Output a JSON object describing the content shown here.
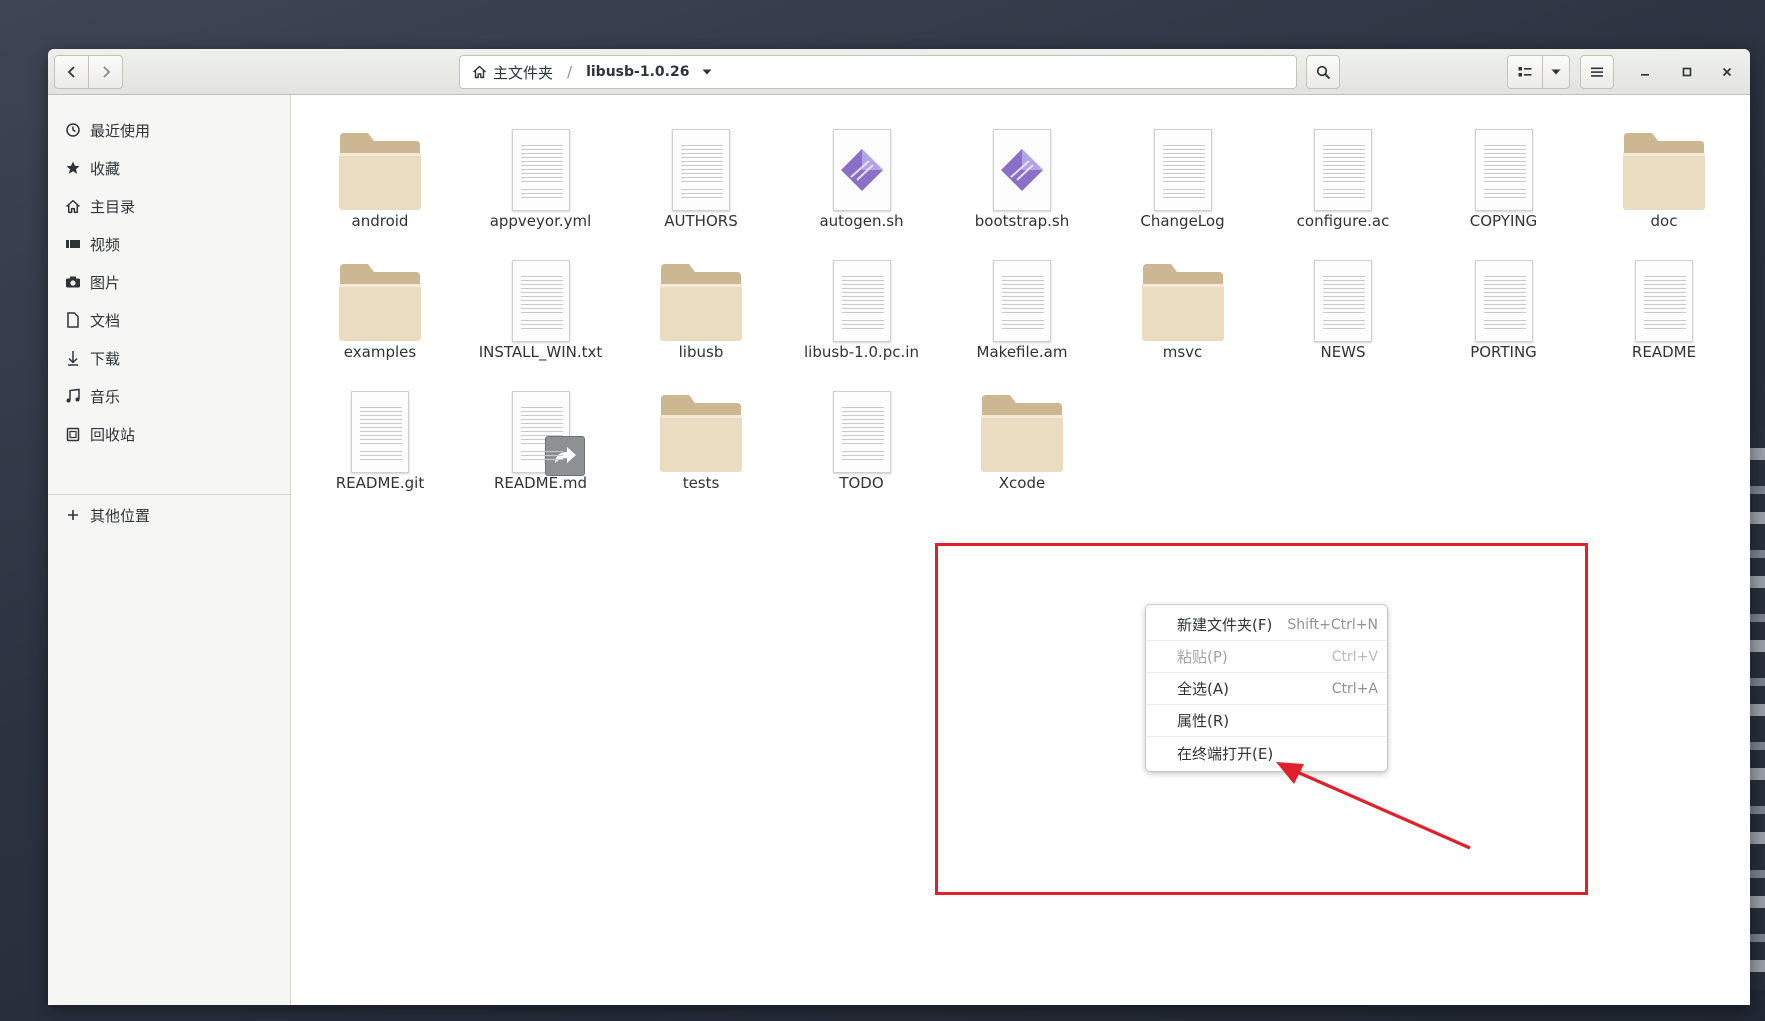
{
  "pathbar": {
    "home_label": "主文件夹",
    "current_folder": "libusb-1.0.26"
  },
  "sidebar": {
    "items": [
      {
        "label": "最近使用",
        "icon": "clock-icon"
      },
      {
        "label": "收藏",
        "icon": "star-icon"
      },
      {
        "label": "主目录",
        "icon": "home-icon"
      },
      {
        "label": "视频",
        "icon": "video-icon"
      },
      {
        "label": "图片",
        "icon": "camera-icon"
      },
      {
        "label": "文档",
        "icon": "document-icon"
      },
      {
        "label": "下载",
        "icon": "download-icon"
      },
      {
        "label": "音乐",
        "icon": "music-icon"
      },
      {
        "label": "回收站",
        "icon": "trash-icon"
      }
    ],
    "other_locations": {
      "label": "其他位置",
      "icon": "plus-icon"
    }
  },
  "files": [
    {
      "name": "android",
      "kind": "folder"
    },
    {
      "name": "appveyor.yml",
      "kind": "text"
    },
    {
      "name": "AUTHORS",
      "kind": "text"
    },
    {
      "name": "autogen.sh",
      "kind": "script"
    },
    {
      "name": "bootstrap.sh",
      "kind": "script"
    },
    {
      "name": "ChangeLog",
      "kind": "text"
    },
    {
      "name": "configure.ac",
      "kind": "text"
    },
    {
      "name": "COPYING",
      "kind": "text"
    },
    {
      "name": "doc",
      "kind": "folder"
    },
    {
      "name": "examples",
      "kind": "folder"
    },
    {
      "name": "INSTALL_WIN.txt",
      "kind": "text"
    },
    {
      "name": "libusb",
      "kind": "folder"
    },
    {
      "name": "libusb-1.0.pc.in",
      "kind": "text"
    },
    {
      "name": "Makefile.am",
      "kind": "text"
    },
    {
      "name": "msvc",
      "kind": "folder"
    },
    {
      "name": "NEWS",
      "kind": "text"
    },
    {
      "name": "PORTING",
      "kind": "text"
    },
    {
      "name": "README",
      "kind": "text"
    },
    {
      "name": "README.git",
      "kind": "text"
    },
    {
      "name": "README.md",
      "kind": "symlink"
    },
    {
      "name": "tests",
      "kind": "folder"
    },
    {
      "name": "TODO",
      "kind": "text"
    },
    {
      "name": "Xcode",
      "kind": "folder"
    }
  ],
  "context_menu": {
    "items": [
      {
        "label": "新建文件夹(F)",
        "accel": "Shift+Ctrl+N",
        "enabled": true
      },
      {
        "label": "粘贴(P)",
        "accel": "Ctrl+V",
        "enabled": false
      },
      {
        "label": "全选(A)",
        "accel": "Ctrl+A",
        "enabled": true
      },
      {
        "label": "属性(R)",
        "accel": "",
        "enabled": true
      },
      {
        "label": "在终端打开(E)",
        "accel": "",
        "enabled": true
      }
    ]
  },
  "colors": {
    "annotation_red": "#e0202a",
    "folder_body": "#eadcc0",
    "folder_tab": "#cbb893",
    "script_icon": "#8a6fc7"
  }
}
